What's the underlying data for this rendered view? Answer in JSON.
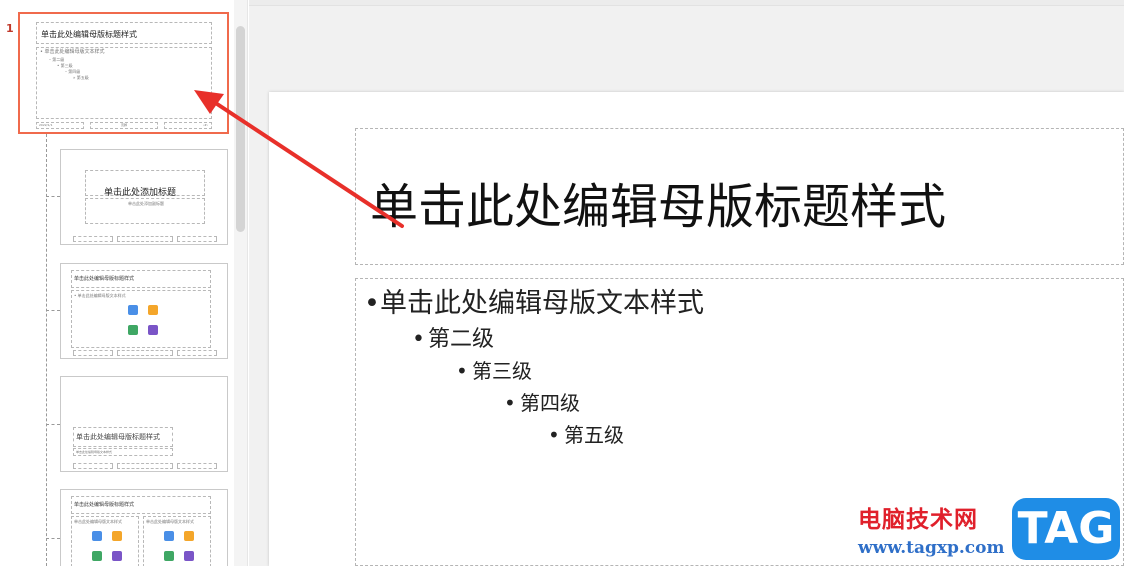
{
  "sidebar": {
    "slide_number": "1",
    "master": {
      "title": "单击此处编辑母版标题样式",
      "bullets": [
        "• 单击此处编辑母版文本样式",
        "– 第二级",
        "• 第三级",
        "– 第四级",
        "» 第五级"
      ],
      "footer_left": "2022/1/1",
      "footer_center": "页脚",
      "footer_right": "‹#›"
    },
    "layout_title": {
      "title": "单击此处添加标题",
      "subtitle": "单击此处添加副标题"
    },
    "layout_content": {
      "title": "单击此处编辑母版标题样式",
      "body": "• 单击此处编辑母版文本样式"
    },
    "layout_section": {
      "title": "单击此处编辑母版标题样式",
      "subtitle": "单击此处编辑母版文本样式"
    },
    "layout_two": {
      "title": "单击此处编辑母版标题样式",
      "left_body": "单击此处编辑母版文本样式",
      "right_body": "单击此处编辑母版文本样式"
    }
  },
  "slide": {
    "title": "单击此处编辑母版标题样式",
    "levels": [
      {
        "bullet": "•",
        "text": "单击此处编辑母版文本样式"
      },
      {
        "bullet": "•",
        "text": "第二级"
      },
      {
        "bullet": "•",
        "text": "第三级"
      },
      {
        "bullet": "•",
        "text": "第四级"
      },
      {
        "bullet": "•",
        "text": "第五级"
      }
    ]
  },
  "watermark": {
    "site_name": "电脑技术网",
    "url": "www.tagxp.com",
    "badge": "TAG"
  },
  "colors": {
    "selected_border": "#f06a4c",
    "arrow": "#e8302a",
    "watermark_red": "#e0202b",
    "watermark_blue": "#1f8de6"
  }
}
